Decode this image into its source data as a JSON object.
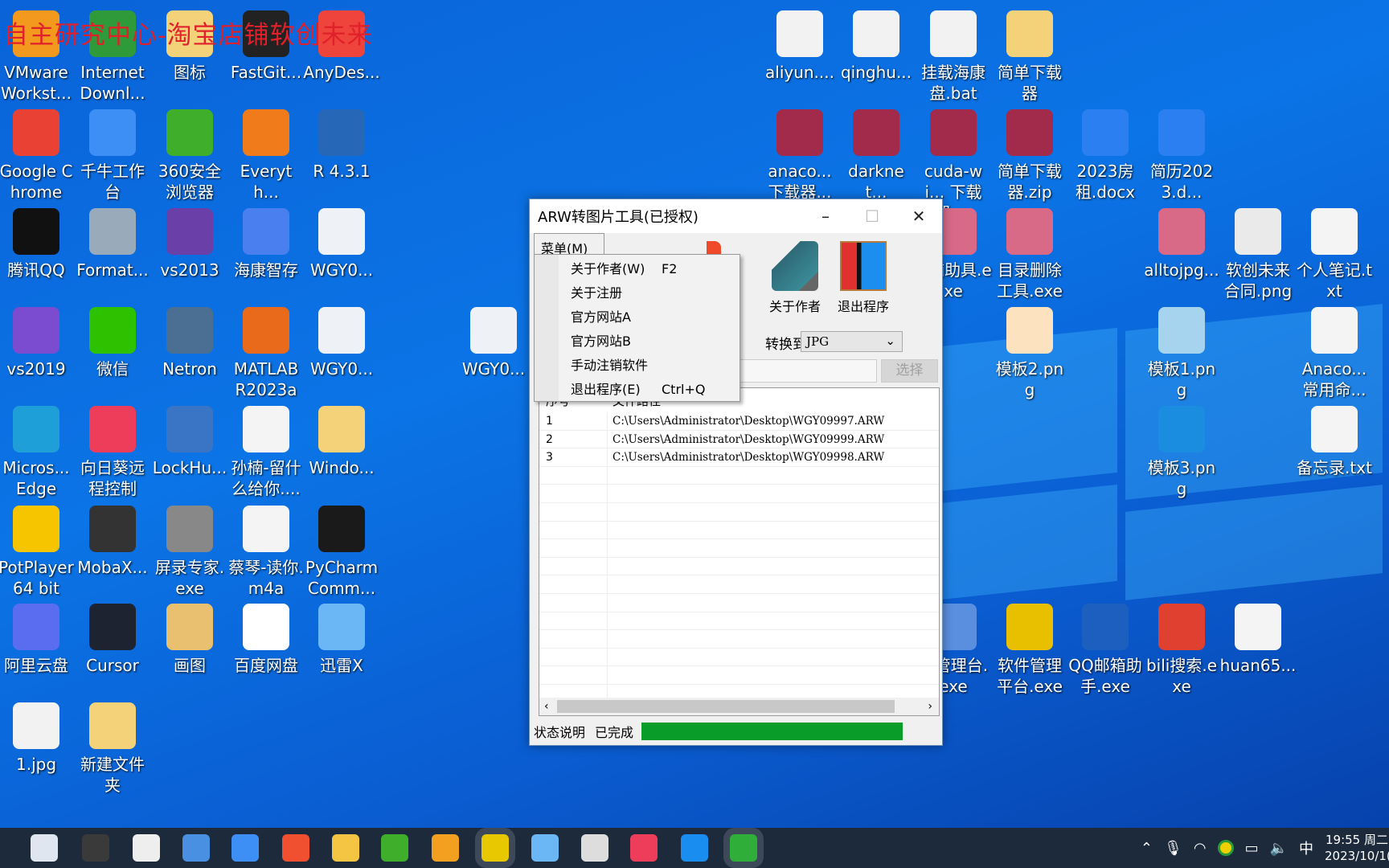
{
  "watermark": "自主研究中心-淘宝店铺软创未来",
  "desktop": {
    "icons": [
      {
        "label": "VMware Workst...",
        "icon": "vmware-icon",
        "color": "#f39a1e"
      },
      {
        "label": "Internet Downl...",
        "icon": "idm-globe-icon",
        "color": "#2f9a3a"
      },
      {
        "label": "图标",
        "icon": "folder-icon",
        "color": "#f4d27a"
      },
      {
        "label": "FastGit...",
        "icon": "fastgithub-icon",
        "color": "#222"
      },
      {
        "label": "AnyDes...",
        "icon": "anydesk-icon",
        "color": "#ef443b"
      },
      {
        "label": "Google Chrome",
        "icon": "chrome-icon",
        "color": "#e94235"
      },
      {
        "label": "千牛工作台",
        "icon": "qianniu-icon",
        "color": "#3d8ff5"
      },
      {
        "label": "360安全浏览器",
        "icon": "360-browser-icon",
        "color": "#3fae2a"
      },
      {
        "label": "Everyth...",
        "icon": "everything-search-icon",
        "color": "#f07b1a"
      },
      {
        "label": "R 4.3.1",
        "icon": "r-icon",
        "color": "#2767b7"
      },
      {
        "label": "腾讯QQ",
        "icon": "qq-penguin-icon",
        "color": "#111"
      },
      {
        "label": "Format...",
        "icon": "format-factory-icon",
        "color": "#9ab"
      },
      {
        "label": "vs2013",
        "icon": "visual-studio-icon",
        "color": "#6b3fa8"
      },
      {
        "label": "海康智存",
        "icon": "hikvision-icon",
        "color": "#4a7ff0"
      },
      {
        "label": "WGY0...",
        "icon": "raw-file-icon",
        "color": "#eef2f7"
      },
      {
        "label": "vs2019",
        "icon": "visual-studio-icon",
        "color": "#7b4bd0"
      },
      {
        "label": "微信",
        "icon": "wechat-icon",
        "color": "#2dc100"
      },
      {
        "label": "Netron",
        "icon": "netron-icon",
        "color": "#4b6f92"
      },
      {
        "label": "MATLAB R2023a",
        "icon": "matlab-icon",
        "color": "#e86a1a"
      },
      {
        "label": "WGY0...",
        "icon": "raw-file-icon",
        "color": "#eef2f7"
      },
      {
        "label": "Micros... Edge",
        "icon": "edge-icon",
        "color": "#1f9fd8"
      },
      {
        "label": "向日葵远程控制",
        "icon": "sunlogin-icon",
        "color": "#ee3d5b"
      },
      {
        "label": "LockHu...",
        "icon": "lockhunter-icon",
        "color": "#3a74c4"
      },
      {
        "label": "孙楠-留什么给你....",
        "icon": "audio-file-icon",
        "color": "#f4f4f4"
      },
      {
        "label": "Windo...",
        "icon": "folder-icon",
        "color": "#f4d27a"
      },
      {
        "label": "PotPlayer 64 bit",
        "icon": "potplayer-icon",
        "color": "#f7c500"
      },
      {
        "label": "MobaX...",
        "icon": "mobaxterm-icon",
        "color": "#333"
      },
      {
        "label": "屏录专家.exe",
        "icon": "screen-recorder-icon",
        "color": "#888"
      },
      {
        "label": "蔡琴-读你.m4a",
        "icon": "audio-file-icon",
        "color": "#f4f4f4"
      },
      {
        "label": "PyCharm Comm...",
        "icon": "pycharm-icon",
        "color": "#1a1a1a"
      },
      {
        "label": "阿里云盘",
        "icon": "aliyun-drive-icon",
        "color": "#5a6cf0"
      },
      {
        "label": "Cursor",
        "icon": "cursor-app-icon",
        "color": "#1d2330"
      },
      {
        "label": "画图",
        "icon": "paint-icon",
        "color": "#e8c070"
      },
      {
        "label": "百度网盘",
        "icon": "baidu-netdisk-icon",
        "color": "#ffffff"
      },
      {
        "label": "迅雷X",
        "icon": "xunlei-icon",
        "color": "#6bb6f5"
      },
      {
        "label": "1.jpg",
        "icon": "image-file-icon",
        "color": "#f2f2f2"
      },
      {
        "label": "新建文件夹",
        "icon": "folder-icon",
        "color": "#f4d27a"
      },
      {
        "label": "WGY0...",
        "icon": "raw-file-icon",
        "color": "#eef2f7"
      },
      {
        "label": "aliyun....",
        "icon": "bat-file-icon",
        "color": "#f2f2f2"
      },
      {
        "label": "qinghu...",
        "icon": "bat-file-icon",
        "color": "#f2f2f2"
      },
      {
        "label": "挂载海康盘.bat",
        "icon": "bat-file-icon",
        "color": "#f2f2f2"
      },
      {
        "label": "简单下载器",
        "icon": "folder-icon",
        "color": "#f4d27a"
      },
      {
        "label": "anaco... 下载器...",
        "icon": "winrar-icon",
        "color": "#a22a4a"
      },
      {
        "label": "darknet...",
        "icon": "winrar-icon",
        "color": "#a22a4a"
      },
      {
        "label": "cuda-wi... 下载器-...",
        "icon": "winrar-icon",
        "color": "#a22a4a"
      },
      {
        "label": "简单下载器.zip",
        "icon": "winrar-icon",
        "color": "#a22a4a"
      },
      {
        "label": "2023房租.docx",
        "icon": "word-doc-icon",
        "color": "#2b7ff0"
      },
      {
        "label": "简历2023.d...",
        "icon": "word-doc-icon",
        "color": "#2b7ff0"
      },
      {
        "label": "+辅助具.exe",
        "icon": "firc-smart-icon",
        "color": "#d86a88"
      },
      {
        "label": "目录删除工具.exe",
        "icon": "firc-smart-icon",
        "color": "#d86a88"
      },
      {
        "label": "alltojpg...",
        "icon": "smart-icon",
        "color": "#d86a88"
      },
      {
        "label": "软创未来合同.png",
        "icon": "image-file-icon",
        "color": "#eaeaea"
      },
      {
        "label": "个人笔记.txt",
        "icon": "text-file-icon",
        "color": "#f4f4f4"
      },
      {
        "label": "模板2.png",
        "icon": "image-file-icon",
        "color": "#fde2c0"
      },
      {
        "label": "模板1.png",
        "icon": "image-file-icon",
        "color": "#a6d4ee"
      },
      {
        "label": "Anaco... 常用命...",
        "icon": "text-file-icon",
        "color": "#f4f4f4"
      },
      {
        "label": "模板3.png",
        "icon": "image-file-icon",
        "color": "#1b8de0"
      },
      {
        "label": "备忘录.txt",
        "icon": "text-file-icon",
        "color": "#f4f4f4"
      },
      {
        "label": "当管理台.exe",
        "icon": "software-manager-icon",
        "color": "#5a8fe0"
      },
      {
        "label": "软件管理平台.exe",
        "icon": "software-manager-icon",
        "color": "#e8c000"
      },
      {
        "label": "QQ邮箱助手.exe",
        "icon": "mailbox-icon",
        "color": "#1d5fbf"
      },
      {
        "label": "bili搜索.exe",
        "icon": "search-magnifier-icon",
        "color": "#e04030"
      },
      {
        "label": "huan65...",
        "icon": "document-icon",
        "color": "#f4f4f4"
      }
    ]
  },
  "window": {
    "title": "ARW转图片工具(已授权)",
    "menu_label": "菜单(M)",
    "menu_items": [
      {
        "label": "关于作者(W)",
        "shortcut": "F2"
      },
      {
        "label": "关于注册",
        "shortcut": ""
      },
      {
        "label": "官方网站A",
        "shortcut": ""
      },
      {
        "label": "官方网站B",
        "shortcut": ""
      },
      {
        "label": "手动注销软件",
        "shortcut": ""
      },
      {
        "label": "退出程序(E)",
        "shortcut": "Ctrl+Q"
      }
    ],
    "toolbar": {
      "convert_partial": "换",
      "about": "关于作者",
      "exit": "退出程序"
    },
    "convert_to_label": "转换到",
    "format_value": "JPG",
    "select_button": "选择",
    "table": {
      "headers": [
        "序号",
        "文件路径"
      ],
      "rows": [
        [
          "1",
          "C:\\Users\\Administrator\\Desktop\\WGY09997.ARW"
        ],
        [
          "2",
          "C:\\Users\\Administrator\\Desktop\\WGY09999.ARW"
        ],
        [
          "3",
          "C:\\Users\\Administrator\\Desktop\\WGY09998.ARW"
        ]
      ]
    },
    "status_label": "状态说明",
    "status_value": "已完成",
    "progress_percent": 100,
    "progress_color": "#0a9c28"
  },
  "taskbar": {
    "apps": [
      {
        "icon": "notepad-icon",
        "color": "#dfe6ef"
      },
      {
        "icon": "obs-icon",
        "color": "#3a3a3a"
      },
      {
        "icon": "upx-icon",
        "color": "#eee"
      },
      {
        "icon": "notebook-icon",
        "color": "#4a90e2"
      },
      {
        "icon": "qianniu-icon",
        "color": "#3d8ff5"
      },
      {
        "icon": "git-icon",
        "color": "#f05030"
      },
      {
        "icon": "file-explorer-icon",
        "color": "#f4c542"
      },
      {
        "icon": "360-browser-icon",
        "color": "#3fae2a"
      },
      {
        "icon": "emoji-app-icon",
        "color": "#f3a020"
      },
      {
        "icon": "audio-app-icon",
        "color": "#e8c800",
        "active": true
      },
      {
        "icon": "xunlei-icon",
        "color": "#6bb6f5"
      },
      {
        "icon": "potplayer-icon",
        "color": "#ddd"
      },
      {
        "icon": "sunlogin-icon",
        "color": "#ee3d5b"
      },
      {
        "icon": "todesk-icon",
        "color": "#1a8ef0"
      },
      {
        "icon": "arw-tool-icon",
        "color": "#2fae3a",
        "active": true
      }
    ],
    "tray": {
      "ime": "中",
      "time": "19:55 周二",
      "date": "2023/10/1("
    }
  }
}
